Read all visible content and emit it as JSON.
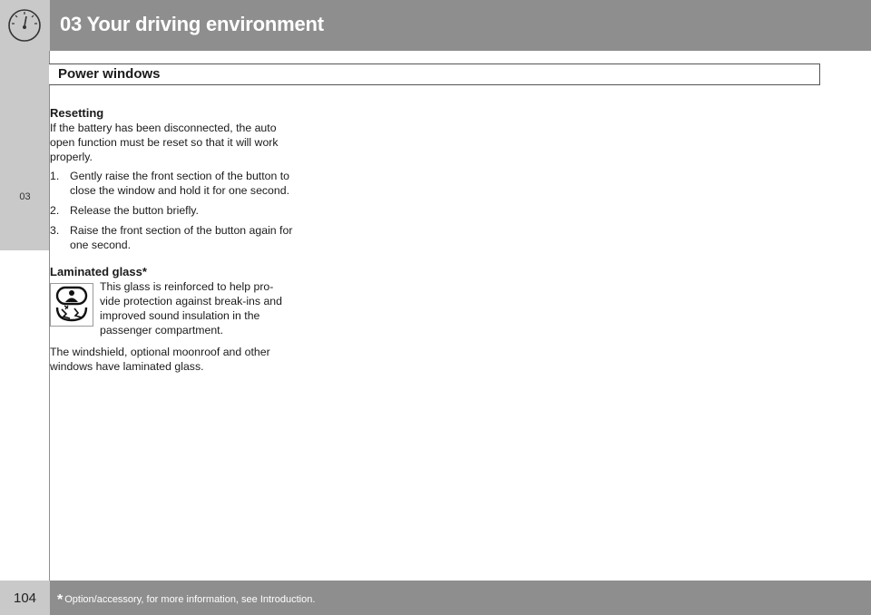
{
  "header": {
    "chapter_title": "03 Your driving environment",
    "icon": "gauge-icon"
  },
  "sidebar": {
    "chapter_tab": "03"
  },
  "section": {
    "title": "Power windows"
  },
  "resetting": {
    "heading": "Resetting",
    "intro": "If the battery has been disconnected, the auto open function must be reset so that it will work properly.",
    "steps": [
      {
        "num": "1.",
        "text": "Gently raise the front section of the button to close the window and hold it for one second."
      },
      {
        "num": "2.",
        "text": "Release the button briefly."
      },
      {
        "num": "3.",
        "text": "Raise the front section of the button again for one second."
      }
    ]
  },
  "laminated": {
    "heading": "Laminated glass*",
    "icon": "laminated-glass-icon",
    "text": "This glass is reinforced to help pro-vide protection against break-ins and improved sound insulation in the passenger compartment.",
    "after": "The windshield, optional moonroof and other windows have laminated glass."
  },
  "footer": {
    "page_number": "104",
    "star": "*",
    "footnote": "Option/accessory, for more information, see Introduction."
  }
}
